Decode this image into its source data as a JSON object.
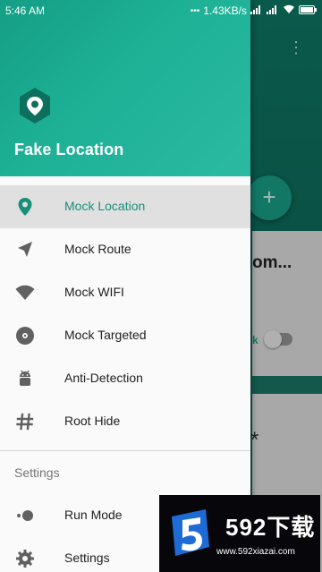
{
  "status_bar": {
    "time": "5:46 AM",
    "network_speed": "1.43KB/s"
  },
  "drawer": {
    "title": "Fake Location",
    "menu_items": [
      {
        "label": "Mock Location",
        "icon": "location-pin-icon",
        "active": true
      },
      {
        "label": "Mock Route",
        "icon": "navigation-arrow-icon",
        "active": false
      },
      {
        "label": "Mock WIFI",
        "icon": "wifi-icon",
        "active": false
      },
      {
        "label": "Mock Targeted",
        "icon": "target-disc-icon",
        "active": false
      },
      {
        "label": "Anti-Detection",
        "icon": "android-icon",
        "active": false
      },
      {
        "label": "Root Hide",
        "icon": "hash-icon",
        "active": false
      }
    ],
    "section_title": "Settings",
    "settings_items": [
      {
        "label": "Run Mode",
        "icon": "toggle-dots-icon"
      },
      {
        "label": "Settings",
        "icon": "gear-icon"
      }
    ]
  },
  "background": {
    "card_title": "om...",
    "card_toggle_text": "k",
    "fab_label": "+",
    "overflow": "⋮",
    "asterisk": "*"
  },
  "watermark": {
    "text": "592下载",
    "url": "www.592xiazai.com"
  },
  "colors": {
    "accent": "#178f7a",
    "header_gradient_start": "#149e86",
    "header_gradient_end": "#2bb9a2"
  }
}
